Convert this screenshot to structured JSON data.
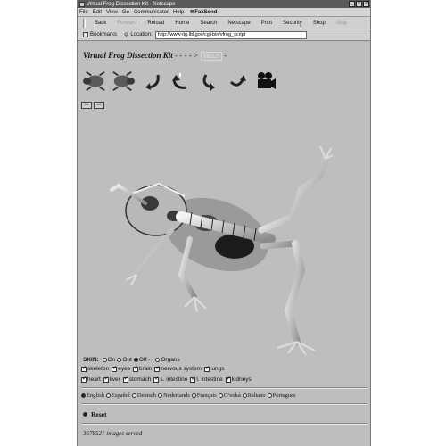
{
  "window": {
    "title": "Virtual Frog Dissection Kit - Netscape"
  },
  "menu": {
    "items": [
      "File",
      "Edit",
      "View",
      "Go",
      "Communicator",
      "Help"
    ],
    "plugin": "FaxSend"
  },
  "toolbar": {
    "buttons": [
      {
        "label": "Back",
        "enabled": true
      },
      {
        "label": "Forward",
        "enabled": false
      },
      {
        "label": "Reload",
        "enabled": true
      },
      {
        "label": "Home",
        "enabled": true
      },
      {
        "label": "Search",
        "enabled": true
      },
      {
        "label": "Netscape",
        "enabled": true
      },
      {
        "label": "Print",
        "enabled": true
      },
      {
        "label": "Security",
        "enabled": true
      },
      {
        "label": "Shop",
        "enabled": true
      },
      {
        "label": "Stop",
        "enabled": false
      }
    ]
  },
  "location": {
    "bookmarks_label": "Bookmarks",
    "location_label": "Location:",
    "url": "http://www-itg.lbl.gov/cgi-bin/vfrog_script"
  },
  "kit": {
    "title": "Virtual Frog Dissection Kit",
    "arrows": "- - - - >",
    "help": "HELP",
    "arrow_after": "-"
  },
  "tools": [
    {
      "icon": "frog-rotate-left-icon"
    },
    {
      "icon": "frog-rotate-right-icon"
    },
    {
      "icon": "curved-arrow-down-icon"
    },
    {
      "icon": "curved-arrow-up-icon"
    },
    {
      "icon": "curved-arrow-left-icon"
    },
    {
      "icon": "curved-arrow-right-icon"
    },
    {
      "icon": "movie-camera-icon"
    }
  ],
  "skin": {
    "label": "SKIN:",
    "options": [
      {
        "label": "On",
        "selected": false
      },
      {
        "label": "Out",
        "selected": false
      },
      {
        "label": "Off - -",
        "selected": true
      },
      {
        "label": "Organs",
        "selected": false
      }
    ]
  },
  "organs_row1": [
    {
      "label": "skeleton",
      "checked": true
    },
    {
      "label": "eyes",
      "checked": true
    },
    {
      "label": "brain",
      "checked": true
    },
    {
      "label": "nervous system",
      "checked": true
    },
    {
      "label": "lungs",
      "checked": true
    }
  ],
  "organs_row2": [
    {
      "label": "heart",
      "checked": true
    },
    {
      "label": "liver",
      "checked": true
    },
    {
      "label": "stomach",
      "checked": true
    },
    {
      "label": "s. intestine",
      "checked": true
    },
    {
      "label": "l. intestine",
      "checked": true
    },
    {
      "label": "kidneys",
      "checked": true
    }
  ],
  "languages": [
    {
      "label": "English",
      "selected": true
    },
    {
      "label": "Español",
      "selected": false
    },
    {
      "label": "Deutsch",
      "selected": false
    },
    {
      "label": "Nederlands",
      "selected": false
    },
    {
      "label": "Français",
      "selected": false
    },
    {
      "label": "C^eská",
      "selected": false
    },
    {
      "label": "Italiano",
      "selected": false
    },
    {
      "label": "Portugues",
      "selected": false
    }
  ],
  "reset_label": "Reset",
  "counter_text": "3678521 images served"
}
